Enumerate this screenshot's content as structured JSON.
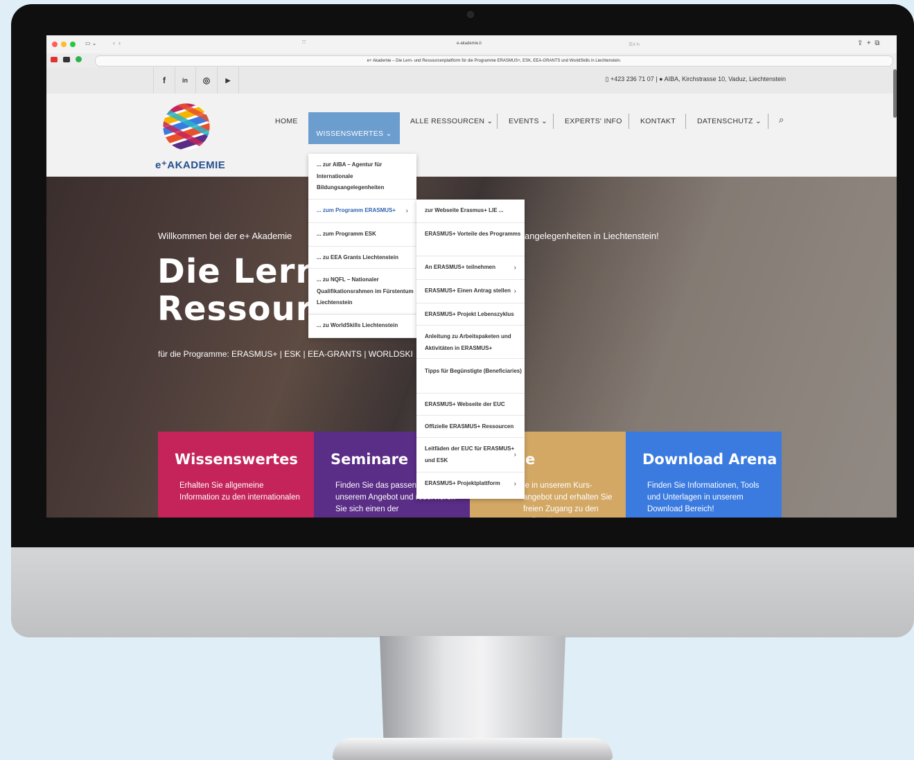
{
  "browser": {
    "url": "e-akademie.li",
    "tab_title": "e+ Akademie – Die Lern- und Ressourcenplattform für die Programme ERASMUS+, ESK, EEA-GRANTS und WorldSkills in Liechtenstein."
  },
  "topbar": {
    "social": [
      {
        "name": "facebook-icon",
        "glyph": "f"
      },
      {
        "name": "linkedin-icon",
        "glyph": "in"
      },
      {
        "name": "instagram-icon",
        "glyph": "◎"
      },
      {
        "name": "youtube-icon",
        "glyph": "▶"
      }
    ],
    "phone": "+423 236 71 07",
    "address": "AIBA, Kirchstrasse 10, Vaduz, Liechtenstein"
  },
  "logo": {
    "text": "e⁺AKADEMIE"
  },
  "nav": {
    "home": "HOME",
    "wissenswertes": "WISSENSWERTES",
    "ressourcen": "ALLE RESSOURCEN",
    "events": "EVENTS",
    "experts": "EXPERTS' INFO",
    "kontakt": "KONTAKT",
    "datenschutz": "DATENSCHUTZ"
  },
  "dropdown": [
    "... zur AIBA – Agentur für Internationale Bildungsangelegenheiten",
    "... zum Programm ERASMUS+",
    "... zum Programm ESK",
    "... zu EEA Grants Liechtenstein",
    "... zu NQFL – Nationaler Qualifikationsrahmen im Fürstentum Liechtenstein",
    "... zu WorldSkills Liechtenstein"
  ],
  "submenu": [
    "zur Webseite Erasmus+ LIE ...",
    "ERASMUS+ Vorteile des Programms",
    "An ERASMUS+ teilnehmen",
    "ERASMUS+ Einen Antrag stellen",
    "ERASMUS+ Projekt Lebenszyklus",
    "Anleitung zu Arbeitspaketen und Aktivitäten in ERASMUS+",
    "Tipps für Begünstigte (Beneficiaries)",
    "ERASMUS+ Webseite der EUC",
    "Offizielle ERASMUS+ Ressourcen",
    "Leitfäden der EUC für ERASMUS+ und ESK",
    "ERASMUS+ Projektplattform"
  ],
  "hero": {
    "welcome_left": "Willkommen bei der e+ Akademie",
    "welcome_right": "angelegenheiten in Liechtenstein!",
    "title": "Die Lern-\nRessourc",
    "subtitle": "für die Programme: ERASMUS+ | ESK | EEA-GRANTS | WORLDSKI"
  },
  "tiles": [
    {
      "title": "Wissenswertes",
      "text": "Erhalten Sie allgemeine Information zu den internationalen",
      "color": "#c4245a"
    },
    {
      "title": "Seminare",
      "text": "Finden Sie das passend aus unserem Angebot und reservieren Sie sich einen der",
      "color": "#5a2d86"
    },
    {
      "title": "e",
      "text": "ie in unserem Kurs-angebot und erhalten Sie freien Zugang zu den online-Kursen",
      "color": "#d3a865"
    },
    {
      "title": "Download Arena",
      "text": "Finden Sie Informationen, Tools und Unterlagen in unserem Download Bereich!",
      "color": "#3b7be0"
    }
  ]
}
